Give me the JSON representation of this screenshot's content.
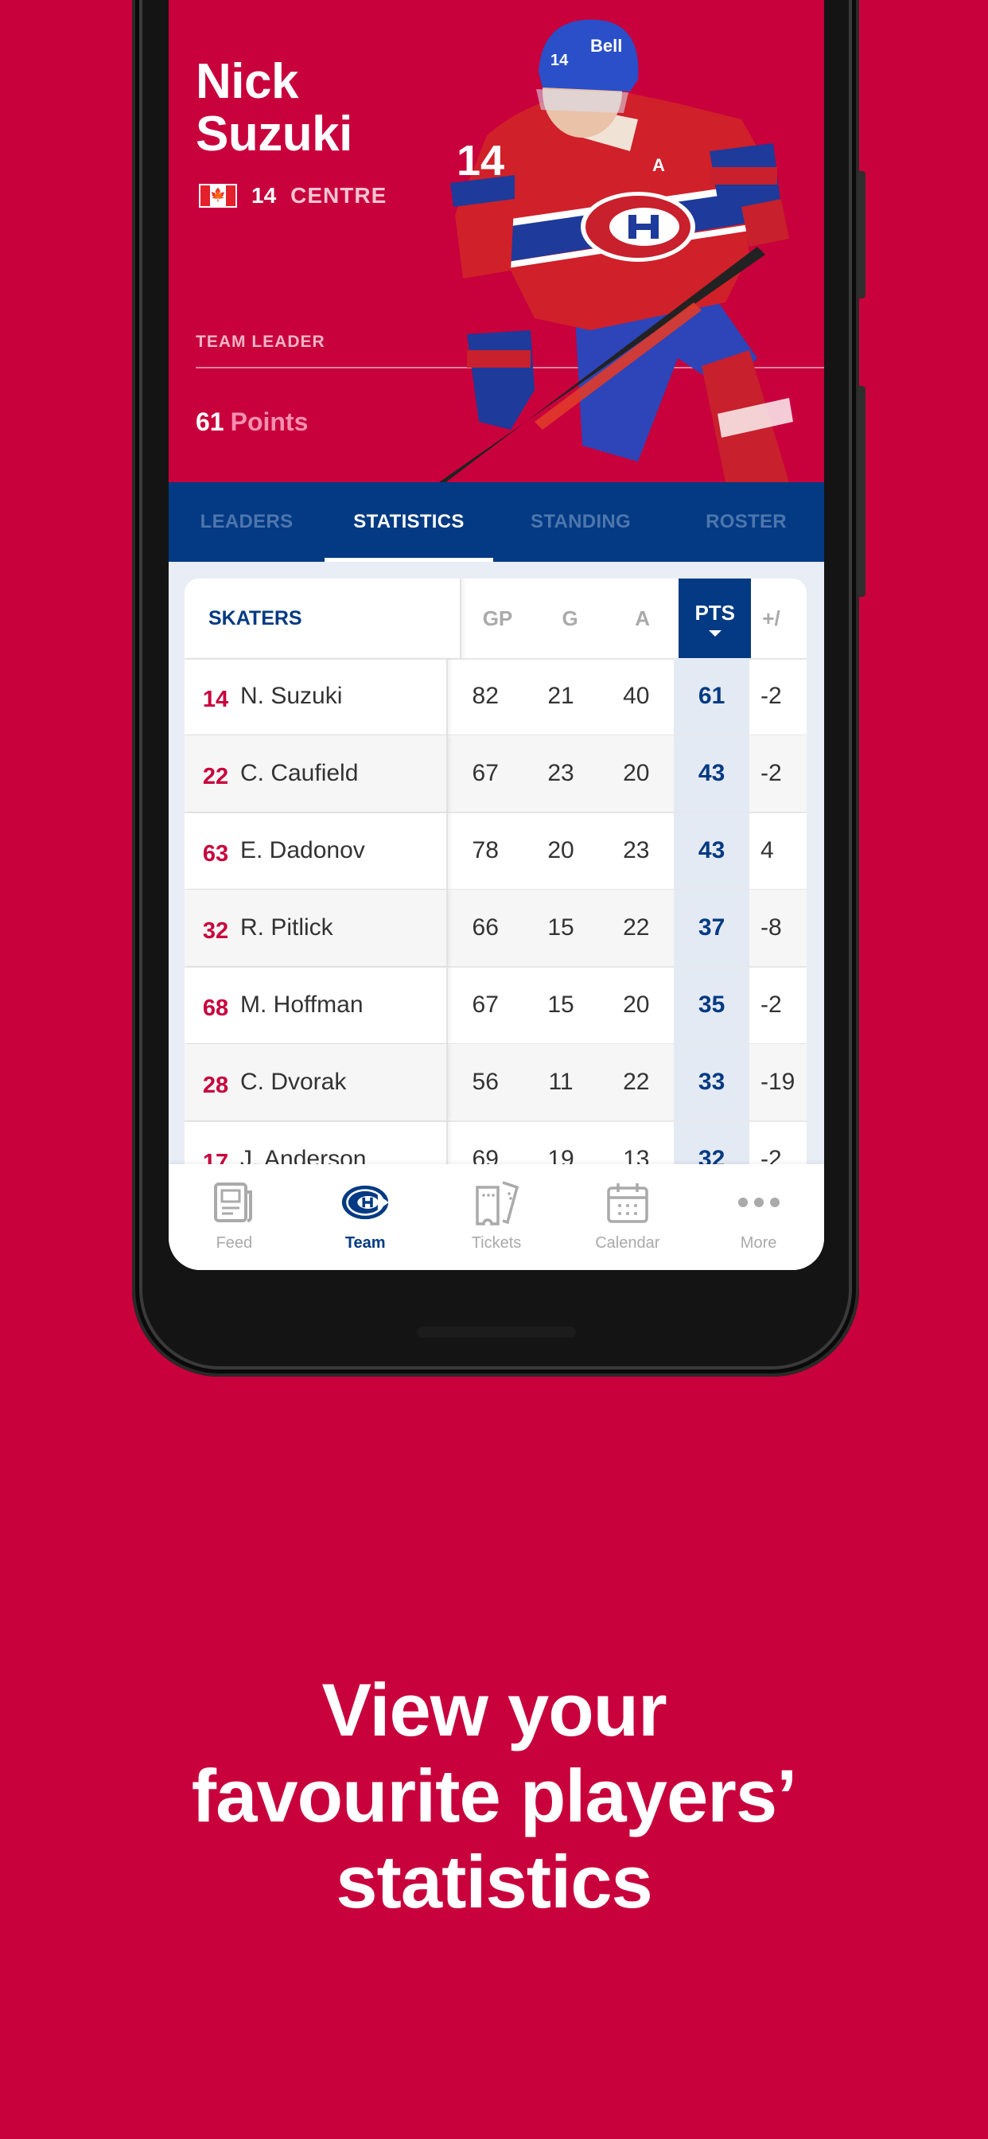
{
  "hero": {
    "first_name": "Nick",
    "last_name": "Suzuki",
    "flag": "canada-flag",
    "number": "14",
    "position": "CENTRE",
    "leader_label": "TEAM LEADER",
    "leader_value": "61",
    "leader_unit": "Points"
  },
  "tabs": [
    {
      "label": "LEADERS",
      "active": false
    },
    {
      "label": "STATISTICS",
      "active": true
    },
    {
      "label": "STANDING",
      "active": false
    },
    {
      "label": "ROSTER",
      "active": false
    }
  ],
  "table": {
    "title": "SKATERS",
    "columns": [
      "GP",
      "G",
      "A",
      "PTS",
      "+/"
    ],
    "sorted_column": "PTS",
    "rows": [
      {
        "number": "14",
        "name": "N. Suzuki",
        "gp": "82",
        "g": "21",
        "a": "40",
        "pts": "61",
        "pm": "-2"
      },
      {
        "number": "22",
        "name": "C. Caufield",
        "gp": "67",
        "g": "23",
        "a": "20",
        "pts": "43",
        "pm": "-2"
      },
      {
        "number": "63",
        "name": "E. Dadonov",
        "gp": "78",
        "g": "20",
        "a": "23",
        "pts": "43",
        "pm": "4"
      },
      {
        "number": "32",
        "name": "R. Pitlick",
        "gp": "66",
        "g": "15",
        "a": "22",
        "pts": "37",
        "pm": "-8"
      },
      {
        "number": "68",
        "name": "M. Hoffman",
        "gp": "67",
        "g": "15",
        "a": "20",
        "pts": "35",
        "pm": "-2"
      },
      {
        "number": "28",
        "name": "C. Dvorak",
        "gp": "56",
        "g": "11",
        "a": "22",
        "pts": "33",
        "pm": "-19"
      },
      {
        "number": "17",
        "name": "J. Anderson",
        "gp": "69",
        "g": "19",
        "a": "13",
        "pts": "32",
        "pm": "-2"
      }
    ]
  },
  "bottom_nav": [
    {
      "label": "Feed",
      "icon": "newspaper-icon",
      "active": false
    },
    {
      "label": "Team",
      "icon": "team-logo-icon",
      "active": true
    },
    {
      "label": "Tickets",
      "icon": "tickets-icon",
      "active": false
    },
    {
      "label": "Calendar",
      "icon": "calendar-icon",
      "active": false
    },
    {
      "label": "More",
      "icon": "more-dots-icon",
      "active": false
    }
  ],
  "caption": {
    "line1": "View your",
    "line2": "favourite players’",
    "line3": "statistics"
  },
  "colors": {
    "brand_red": "#c8003c",
    "brand_blue": "#033a83",
    "inactive_gray": "#aaaaaa"
  }
}
